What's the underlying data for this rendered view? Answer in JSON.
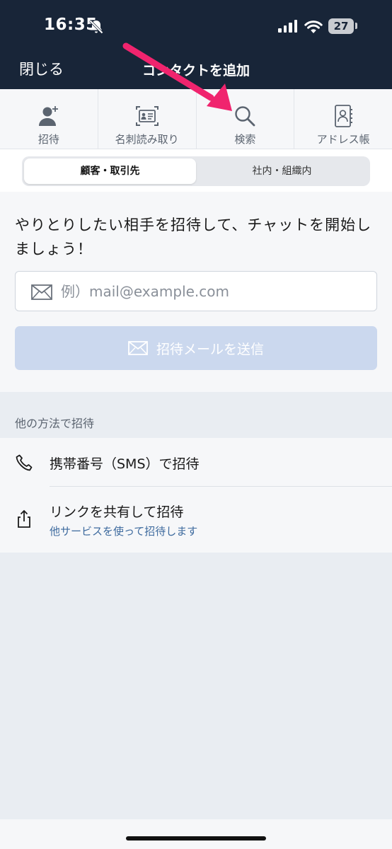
{
  "status_bar": {
    "time": "16:35",
    "battery": "27"
  },
  "nav": {
    "close_label": "閉じる",
    "title": "コンタクトを追加"
  },
  "toolbar": {
    "items": [
      {
        "label": "招待",
        "icon": "add-person-icon"
      },
      {
        "label": "名刺読み取り",
        "icon": "business-card-scan-icon"
      },
      {
        "label": "検索",
        "icon": "search-icon"
      },
      {
        "label": "アドレス帳",
        "icon": "address-book-icon"
      }
    ]
  },
  "segments": {
    "options": [
      "顧客・取引先",
      "社内・組織内"
    ],
    "selected": "顧客・取引先"
  },
  "invite": {
    "message": "やりとりしたい相手を招待して、チャットを開始しましょう！",
    "email_placeholder": "例）mail@example.com",
    "email_value": "",
    "send_label": "招待メールを送信"
  },
  "other_methods": {
    "label": "他の方法で招待",
    "items": [
      {
        "title": "携帯番号（SMS）で招待",
        "icon": "phone-icon"
      },
      {
        "title": "リンクを共有して招待",
        "subtitle": "他サービスを使って招待します",
        "icon": "share-icon"
      }
    ]
  },
  "colors": {
    "nav_bg": "#182538",
    "annotation_arrow": "#f0246e",
    "link_text": "#3d6a9e",
    "send_button_disabled": "#cbd8ee"
  }
}
